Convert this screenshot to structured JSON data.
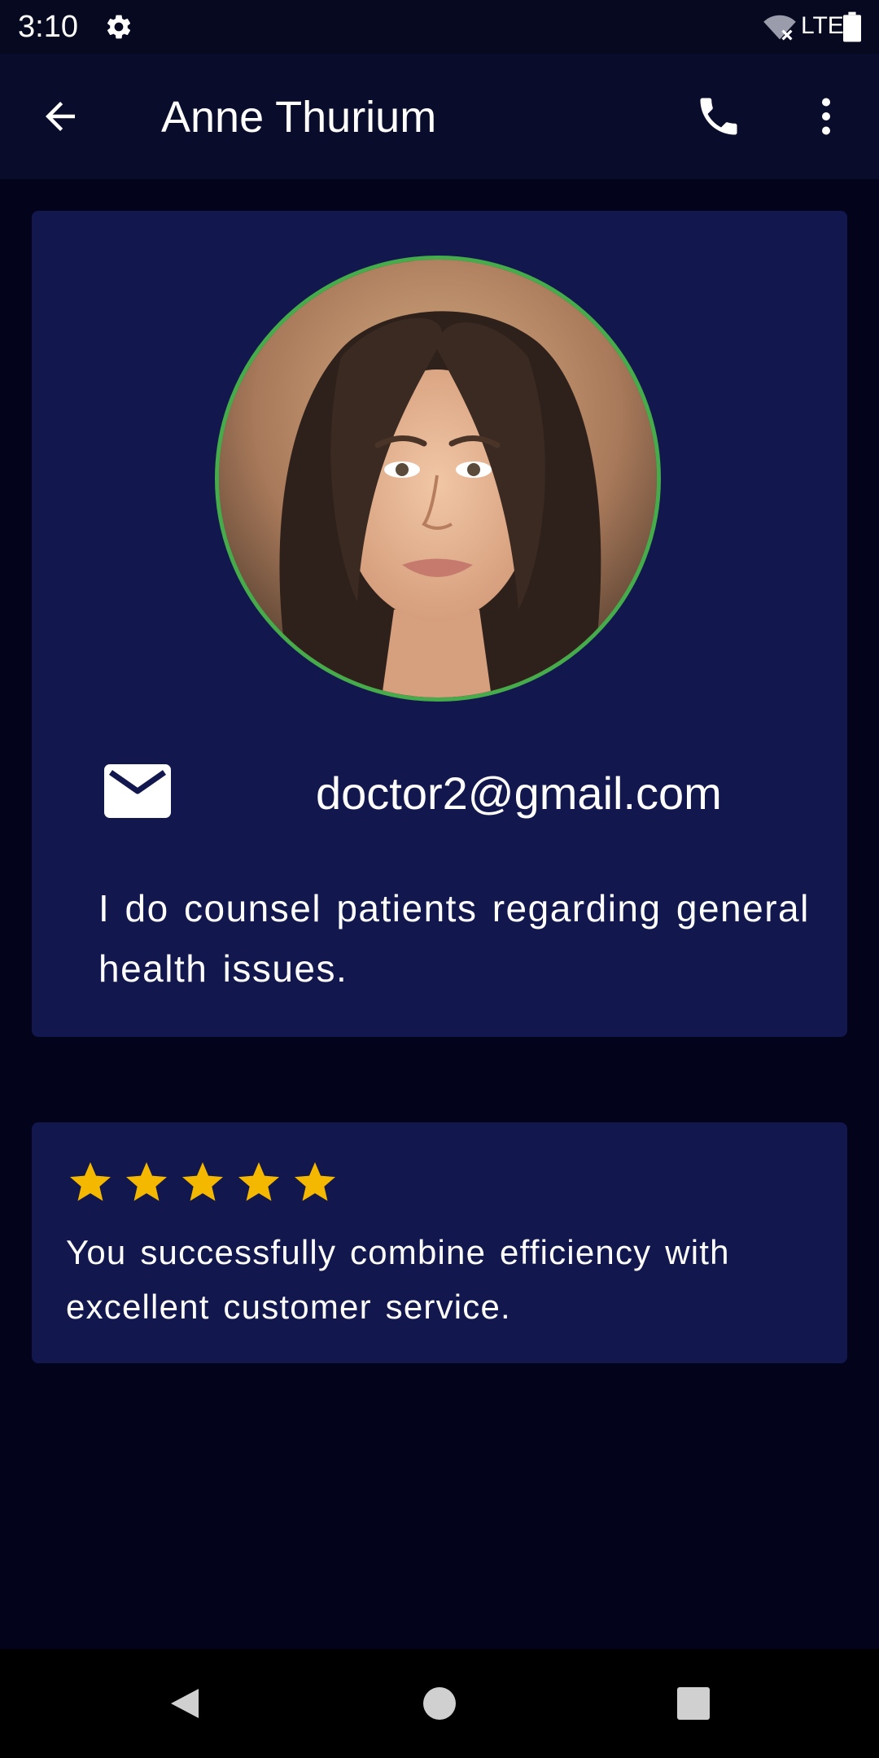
{
  "status_bar": {
    "time": "3:10",
    "network": "LTE",
    "icons": [
      "gear-icon",
      "wifi-off-icon",
      "battery-icon"
    ]
  },
  "app_bar": {
    "title": "Anne Thurium",
    "back_icon": "arrow-left-icon",
    "call_icon": "phone-icon",
    "more_icon": "more-vertical-icon"
  },
  "profile": {
    "avatar_icon": "avatar-photo",
    "avatar_border_color": "#46ab4a",
    "email": "doctor2@gmail.com",
    "email_icon": "mail-icon",
    "bio": "I do counsel patients regarding general health issues."
  },
  "review": {
    "rating": 5,
    "max_rating": 5,
    "star_color": "#f5b800",
    "text": "You successfully combine efficiency with excellent customer service."
  },
  "nav_bar": {
    "icons": [
      "nav-back-icon",
      "nav-home-icon",
      "nav-recents-icon"
    ]
  },
  "colors": {
    "background": "#03031c",
    "card": "#12184d",
    "app_bar": "#090c2b"
  }
}
